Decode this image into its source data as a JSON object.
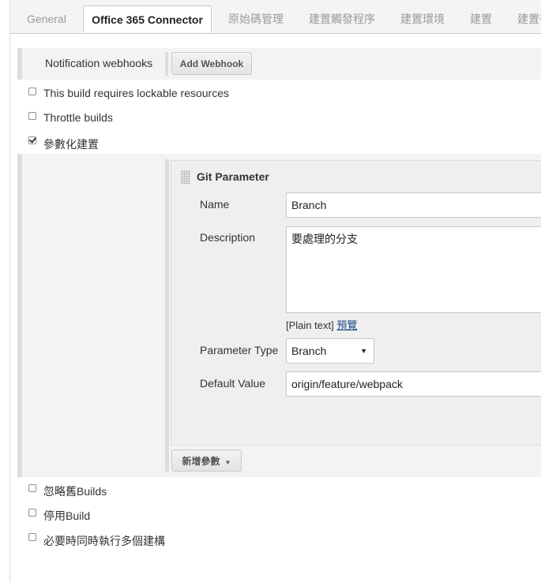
{
  "tabs": [
    {
      "label": "General",
      "active": false
    },
    {
      "label": "Office 365 Connector",
      "active": true
    },
    {
      "label": "原始碼管理",
      "active": false
    },
    {
      "label": "建置觸發程序",
      "active": false
    },
    {
      "label": "建置環境",
      "active": false
    },
    {
      "label": "建置",
      "active": false
    },
    {
      "label": "建置後",
      "active": false
    }
  ],
  "webhooks": {
    "label": "Notification webhooks",
    "add_button": "Add Webhook"
  },
  "options_top": [
    {
      "label": "This build requires lockable resources",
      "checked": false
    },
    {
      "label": "Throttle builds",
      "checked": false
    },
    {
      "label": "參數化建置",
      "checked": true
    }
  ],
  "git_parameter": {
    "title": "Git Parameter",
    "name_label": "Name",
    "name_value": "Branch",
    "description_label": "Description",
    "description_value": "要處理的分支",
    "format_prefix": "[Plain text]",
    "preview_link": "預覽",
    "parameter_type_label": "Parameter Type",
    "parameter_type_value": "Branch",
    "default_value_label": "Default Value",
    "default_value": "origin/feature/webpack"
  },
  "add_parameter_button": "新增參數",
  "options_bottom": [
    {
      "label": "忽略舊Builds",
      "checked": false
    },
    {
      "label": "停用Build",
      "checked": false
    },
    {
      "label": "必要時同時執行多個建構",
      "checked": false
    }
  ]
}
